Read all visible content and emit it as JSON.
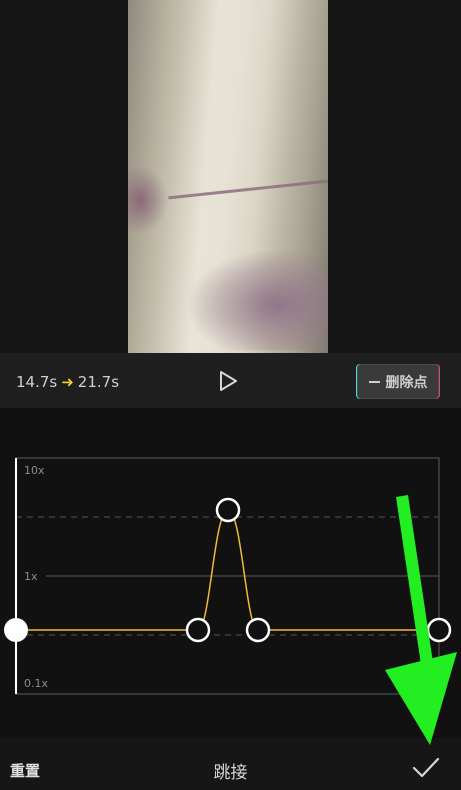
{
  "controls": {
    "start_duration": "14.7s",
    "end_duration": "21.7s",
    "delete_point_label": "删除点"
  },
  "curve": {
    "label_top": "10x",
    "label_mid": "1x",
    "label_bottom": "0.1x",
    "curve_color": "#f0b93a"
  },
  "bottom_bar": {
    "reset_label": "重置",
    "preset_name": "跳接"
  },
  "colors": {
    "accent": "#f3c33a",
    "annotation": "#22ee22"
  }
}
